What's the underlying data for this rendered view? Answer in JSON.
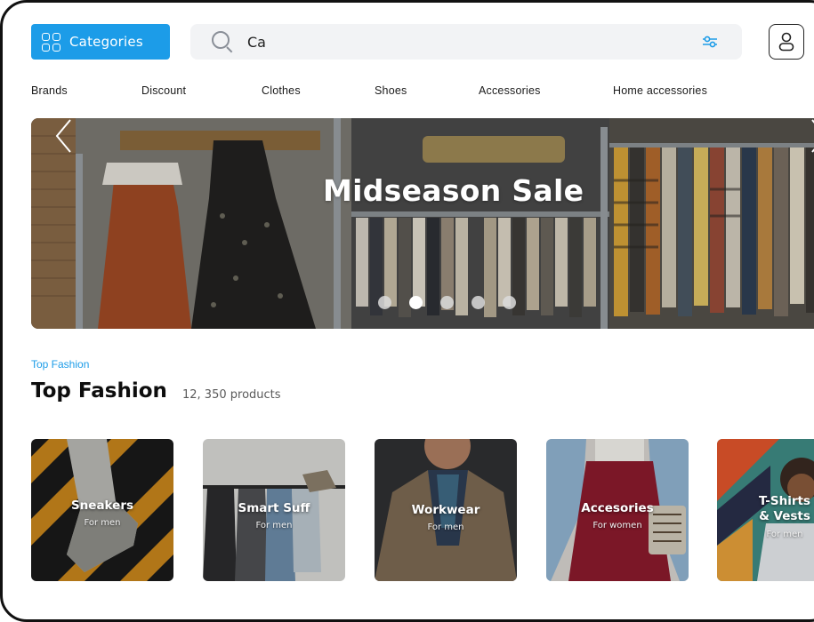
{
  "header": {
    "categories_label": "Categories",
    "search_value": "Ca",
    "accent_color": "#1c9ce8"
  },
  "nav": {
    "items": [
      "Brands",
      "Discount",
      "Clothes",
      "Shoes",
      "Accessories",
      "Home accessories"
    ]
  },
  "banner": {
    "title": "Midseason Sale",
    "slide_count": 5,
    "active_slide": 2
  },
  "section": {
    "crumb": "Top Fashion",
    "title": "Top Fashion",
    "count": "12, 350 products"
  },
  "cards": [
    {
      "title": "Sneakers",
      "subtitle": "For men"
    },
    {
      "title": "Smart Suff",
      "subtitle": "For men"
    },
    {
      "title": "Workwear",
      "subtitle": "For men"
    },
    {
      "title": "Accesories",
      "subtitle": "For women"
    },
    {
      "title": "T-Shirts & Vests",
      "subtitle": "For men"
    }
  ],
  "icons": {
    "categories": "grid-icon",
    "search": "search-icon",
    "filter": "filter-icon",
    "profile": "user-icon",
    "prev": "chevron-left-icon",
    "next": "chevron-right-icon"
  }
}
